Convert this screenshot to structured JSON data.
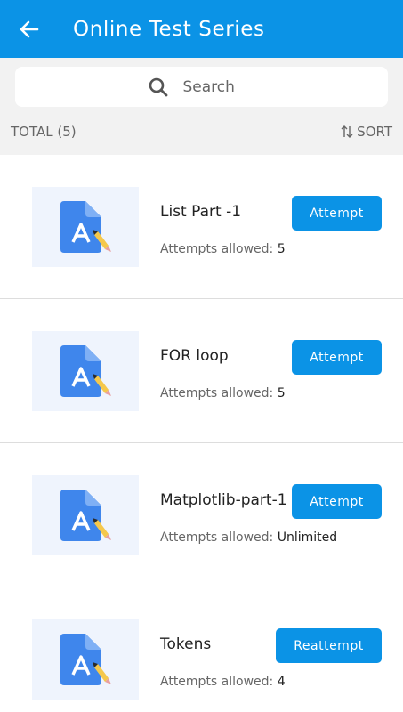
{
  "header": {
    "title": "Online Test Series",
    "back_icon": "arrow-left-icon"
  },
  "search": {
    "placeholder": "Search",
    "icon": "search-icon"
  },
  "toolbar": {
    "total_label": "TOTAL (5)",
    "sort_label": "SORT",
    "sort_icon": "sort-arrows-icon"
  },
  "tests": [
    {
      "title": "List Part -1",
      "attempts_label": "Attempts allowed:",
      "attempts_value": "5",
      "action": "Attempt",
      "icon": "document-edit-icon"
    },
    {
      "title": "FOR loop",
      "attempts_label": "Attempts allowed:",
      "attempts_value": "5",
      "action": "Attempt",
      "icon": "document-edit-icon"
    },
    {
      "title": "Matplotlib-part-1",
      "attempts_label": "Attempts allowed:",
      "attempts_value": "Unlimited",
      "action": "Attempt",
      "icon": "document-edit-icon"
    },
    {
      "title": "Tokens",
      "attempts_label": "Attempts allowed:",
      "attempts_value": "4",
      "action": "Reattempt",
      "icon": "document-edit-icon"
    }
  ],
  "colors": {
    "primary": "#0b93e6",
    "thumb_bg": "#eff4fd",
    "doc_blue": "#3f86ec",
    "pencil": "#f5c84c"
  }
}
